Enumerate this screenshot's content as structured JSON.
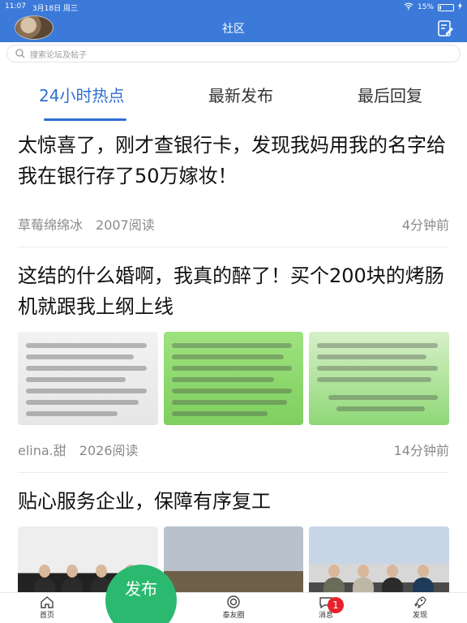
{
  "status_bar": {
    "time": "11:07",
    "date": "3月18日 周三",
    "battery": "15%",
    "battery_level": 0.15
  },
  "header": {
    "title": "社区"
  },
  "search": {
    "placeholder": "搜索论坛及帖子"
  },
  "tabs": [
    {
      "label": "24小时热点",
      "active": true
    },
    {
      "label": "最新发布",
      "active": false
    },
    {
      "label": "最后回复",
      "active": false
    }
  ],
  "posts": [
    {
      "title": "太惊喜了，刚才查银行卡，发现我妈用我的名字给我在银行存了50万嫁妆！",
      "author": "草莓绵绵冰",
      "reads": "2007阅读",
      "time": "4分钟前"
    },
    {
      "title": "这结的什么婚啊，我真的醉了！买个200块的烤肠机就跟我上纲上线",
      "author": "elina.甜",
      "reads": "2026阅读",
      "time": "14分钟前"
    },
    {
      "title": "贴心服务企业，保障有序复工"
    }
  ],
  "tabbar": {
    "home": "首页",
    "publish": "发布",
    "circle": "泰友圈",
    "messages": "消息",
    "messages_badge": "1",
    "discover": "发现"
  },
  "colors": {
    "brand_blue": "#3b7ad9",
    "active_tab": "#2e6fd3",
    "publish_green": "#2bb970",
    "badge_red": "#e6222b"
  }
}
